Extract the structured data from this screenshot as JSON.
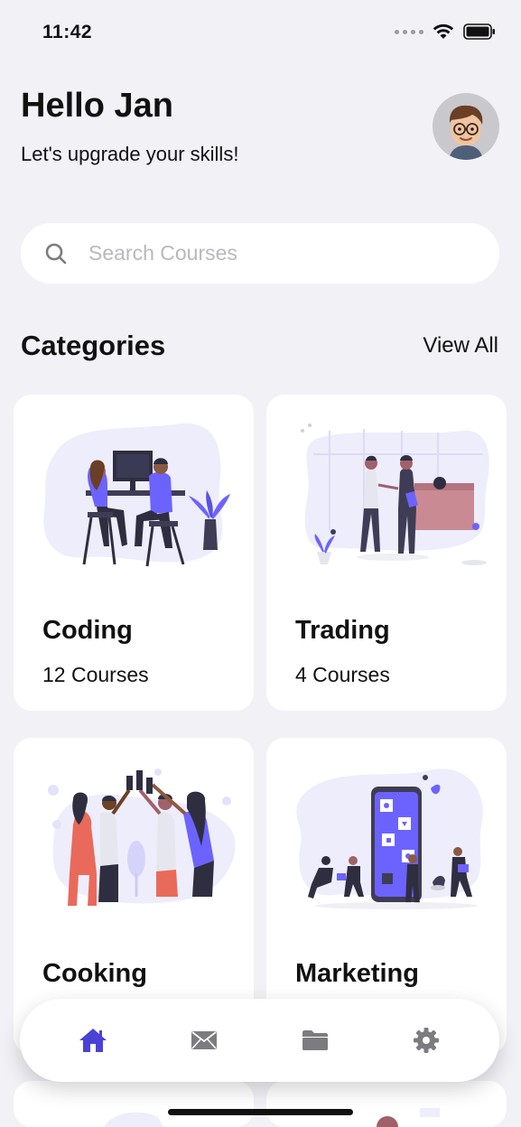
{
  "status": {
    "time": "11:42"
  },
  "header": {
    "greeting": "Hello Jan",
    "subtitle": "Let's upgrade your skills!"
  },
  "search": {
    "placeholder": "Search Courses"
  },
  "categories": {
    "title": "Categories",
    "view_all": "View All",
    "items": [
      {
        "name": "Coding",
        "count": "12 Courses"
      },
      {
        "name": "Trading",
        "count": "4 Courses"
      },
      {
        "name": "Cooking",
        "count": ""
      },
      {
        "name": "Marketing",
        "count": ""
      }
    ]
  },
  "tabbar": {
    "items": [
      "home-icon",
      "mail-icon",
      "folder-icon",
      "gear-icon"
    ],
    "active_color": "#4a42d6",
    "inactive_color": "#7c7c80"
  },
  "colors": {
    "accent": "#5b4ee8",
    "background": "#f2f1f6",
    "blob": "#eeedfc"
  }
}
